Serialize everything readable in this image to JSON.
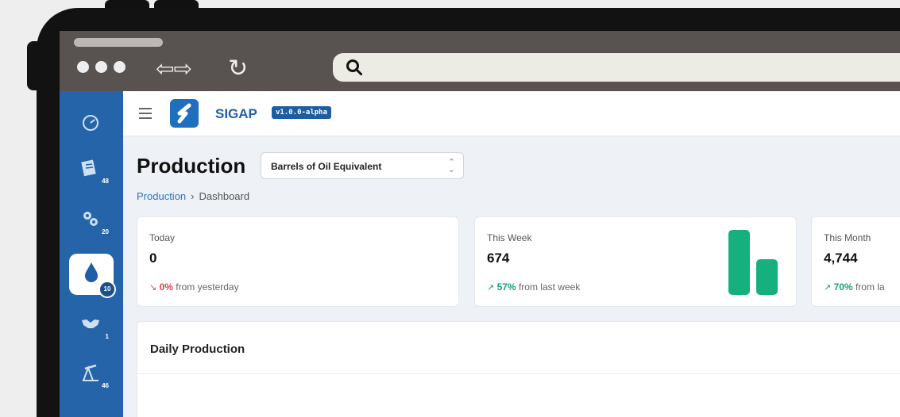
{
  "browser": {
    "back_forward_glyph": "⇦⇨",
    "reload_glyph": "↻",
    "search_icon": "search-icon"
  },
  "sidebar": {
    "items": [
      {
        "icon": "dashboard-gauge-icon",
        "count": ""
      },
      {
        "icon": "documents-icon",
        "count": "48"
      },
      {
        "icon": "gears-icon",
        "count": "20"
      },
      {
        "icon": "oil-drop-icon",
        "count": "10",
        "active": true
      },
      {
        "icon": "handshake-icon",
        "count": "1"
      },
      {
        "icon": "oil-pump-icon",
        "count": "46"
      }
    ]
  },
  "topbar": {
    "brand": "SIGAP",
    "version": "v1.0.0-alpha"
  },
  "page": {
    "title": "Production",
    "unit_select": "Barrels of Oil Equivalent",
    "breadcrumb": {
      "root": "Production",
      "separator": "›",
      "current": "Dashboard"
    }
  },
  "stats": [
    {
      "label": "Today",
      "value": "0",
      "trend_glyph": "↘",
      "pct": "0%",
      "suffix": "from yesterday",
      "direction": "down"
    },
    {
      "label": "This Week",
      "value": "674",
      "trend_glyph": "↗",
      "pct": "57%",
      "suffix": "from last week",
      "direction": "up",
      "mini_bars": [
        1.0,
        0.55
      ]
    },
    {
      "label": "This Month",
      "value": "4,744",
      "trend_glyph": "↗",
      "pct": "70%",
      "suffix": "from la",
      "direction": "up"
    }
  ],
  "panel": {
    "title": "Daily Production"
  },
  "colors": {
    "sidebar": "#2664aa",
    "accent_green": "#16b07f",
    "down_red": "#e0434a"
  }
}
